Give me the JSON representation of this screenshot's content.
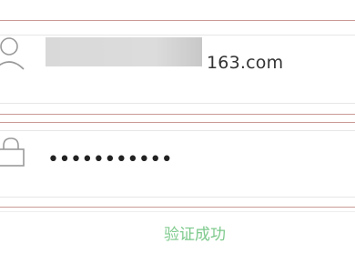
{
  "login_form": {
    "username": {
      "icon": "user-icon",
      "value_suffix": "163.com"
    },
    "password": {
      "icon": "lock-icon",
      "masked_value": "•••••••••••"
    },
    "verification": {
      "status_text": "验证成功",
      "status_color": "#7cc98b"
    }
  }
}
